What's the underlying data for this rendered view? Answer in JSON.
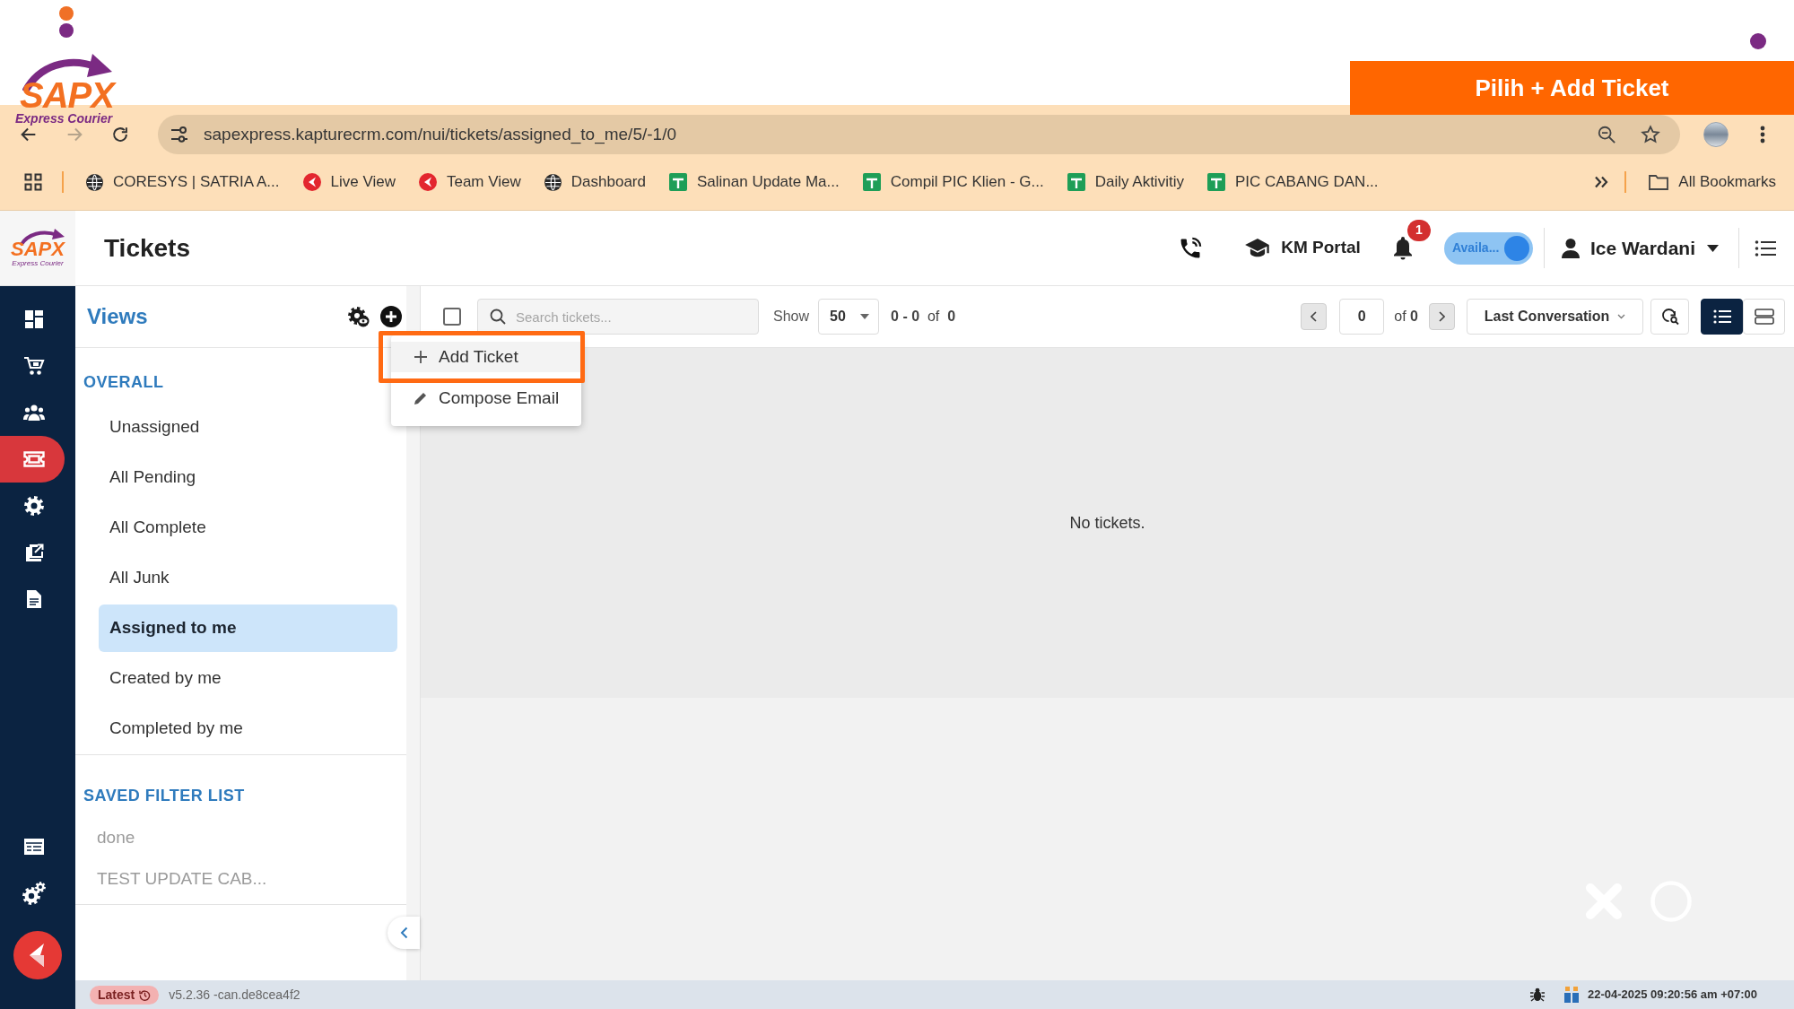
{
  "overlay": {
    "banner": "Pilih + Add Ticket",
    "logo": {
      "wordmark": "SAPX",
      "tagline": "Express Courier"
    }
  },
  "browser": {
    "nav": [
      {
        "kind": "back",
        "disabled": false
      },
      {
        "kind": "forward",
        "disabled": true
      },
      {
        "kind": "reload",
        "disabled": false
      }
    ],
    "url": "sapexpress.kapturecrm.com/nui/tickets/assigned_to_me/5/-1/0",
    "bookmarks": [
      {
        "kind": "globe",
        "label": "CORESYS | SATRIA A..."
      },
      {
        "kind": "kapture",
        "label": "Live View"
      },
      {
        "kind": "kapture",
        "label": "Team View"
      },
      {
        "kind": "globe",
        "label": "Dashboard"
      },
      {
        "kind": "sheet",
        "label": "Salinan Update Ma..."
      },
      {
        "kind": "sheet",
        "label": "Compil PIC Klien - G..."
      },
      {
        "kind": "sheet",
        "label": "Daily Aktivitiy"
      },
      {
        "kind": "sheet",
        "label": "PIC CABANG DAN..."
      }
    ],
    "all_bookmarks": "All Bookmarks"
  },
  "app": {
    "logo": {
      "wordmark": "SAPX",
      "tagline": "Express Courier"
    },
    "title": "Tickets",
    "header": {
      "km_portal": "KM Portal",
      "notifications": "1",
      "availability": {
        "label": "Availa...",
        "on": true
      },
      "user": "Ice Wardani"
    }
  },
  "nav": {
    "top": [
      {
        "kind": "dashboard",
        "selected": false
      },
      {
        "kind": "cart",
        "selected": false
      },
      {
        "kind": "users",
        "selected": false
      },
      {
        "kind": "ticket",
        "selected": true
      },
      {
        "kind": "settings",
        "selected": false
      },
      {
        "kind": "export",
        "selected": false
      },
      {
        "kind": "document",
        "selected": false
      }
    ],
    "bottom": [
      {
        "kind": "table",
        "selected": false
      },
      {
        "kind": "gears",
        "selected": false
      }
    ]
  },
  "views": {
    "title": "Views",
    "sections": [
      {
        "kind": "views",
        "heading": "OVERALL",
        "items": [
          {
            "label": "Unassigned",
            "selected": false
          },
          {
            "label": "All Pending",
            "selected": false
          },
          {
            "label": "All Complete",
            "selected": false
          },
          {
            "label": "All Junk",
            "selected": false
          },
          {
            "label": "Assigned to me",
            "selected": true
          },
          {
            "label": "Created by me",
            "selected": false
          },
          {
            "label": "Completed by me",
            "selected": false
          }
        ]
      },
      {
        "kind": "filters",
        "heading": "SAVED FILTER LIST",
        "items": [
          {
            "label": "done",
            "selected": false
          },
          {
            "label": "TEST UPDATE CAB...",
            "selected": false
          }
        ]
      }
    ]
  },
  "menu": [
    {
      "kind": "add",
      "label": "Add Ticket",
      "highlighted": true
    },
    {
      "kind": "compose",
      "label": "Compose Email",
      "highlighted": false
    }
  ],
  "toolbar": {
    "select_all": {
      "checked": false
    },
    "search": {
      "placeholder": "Search tickets..."
    },
    "show_label": "Show",
    "page_size": "50",
    "range": "**0 - 0**  of  **0**",
    "page": "0",
    "page_total": "of **0**",
    "sort": "Last Conversation",
    "view_modes": [
      {
        "kind": "list",
        "selected": true
      },
      {
        "kind": "cards",
        "selected": false
      }
    ]
  },
  "empty_message": "No tickets.",
  "status_bar": {
    "badge": "Latest",
    "version": "v5.2.36 -can.de8cea4f2",
    "timestamp": "22-04-2025 09:20:56 am +07:00"
  }
}
